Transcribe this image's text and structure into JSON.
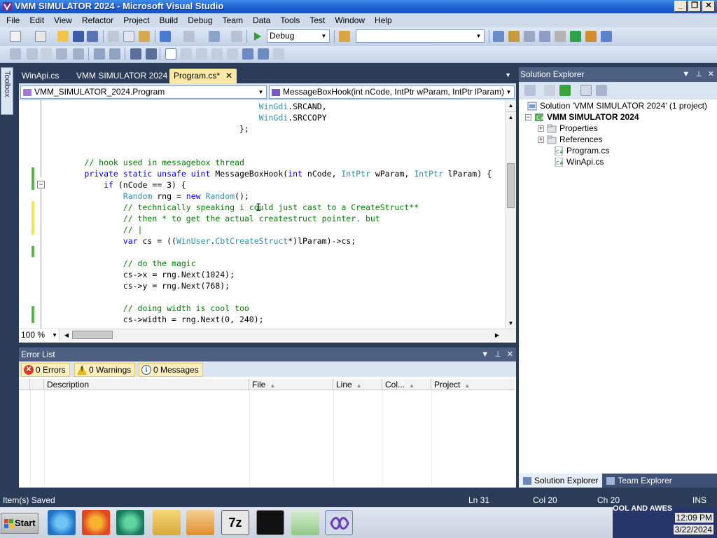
{
  "window": {
    "title": "VMM SIMULATOR 2024 - Microsoft Visual Studio",
    "buttons": [
      "_",
      "❐",
      "✕"
    ]
  },
  "menu": [
    "File",
    "Edit",
    "View",
    "Refactor",
    "Project",
    "Build",
    "Debug",
    "Team",
    "Data",
    "Tools",
    "Test",
    "Window",
    "Help"
  ],
  "toolbar": {
    "config_combo": "Debug",
    "find_combo": ""
  },
  "toolbox_label": "Toolbox",
  "doc_tabs": [
    {
      "label": "WinApi.cs",
      "active": false
    },
    {
      "label": "VMM SIMULATOR 2024",
      "active": false
    },
    {
      "label": "Program.cs*",
      "active": true
    }
  ],
  "nav": {
    "type_combo": "VMM_SIMULATOR_2024.Program",
    "member_combo": "MessageBoxHook(int nCode, IntPtr wParam, IntPtr lParam)"
  },
  "code_lines": [
    {
      "tokens": [
        {
          "t": "                                            "
        },
        {
          "t": "WinGdi",
          "c": "ty"
        },
        {
          "t": ".SRCAND,"
        }
      ]
    },
    {
      "tokens": [
        {
          "t": "                                            "
        },
        {
          "t": "WinGdi",
          "c": "ty"
        },
        {
          "t": ".SRCCOPY"
        }
      ]
    },
    {
      "tokens": [
        {
          "t": "                                        };"
        }
      ]
    },
    {
      "tokens": []
    },
    {
      "tokens": []
    },
    {
      "tokens": [
        {
          "t": "        "
        },
        {
          "t": "// hook used in messagebox thread",
          "c": "cm"
        }
      ]
    },
    {
      "tokens": [
        {
          "t": "        "
        },
        {
          "t": "private static unsafe uint",
          "c": "kw"
        },
        {
          "t": " MessageBoxHook("
        },
        {
          "t": "int",
          "c": "kw"
        },
        {
          "t": " nCode, "
        },
        {
          "t": "IntPtr",
          "c": "ty"
        },
        {
          "t": " wParam, "
        },
        {
          "t": "IntPtr",
          "c": "ty"
        },
        {
          "t": " lParam) {"
        }
      ]
    },
    {
      "tokens": [
        {
          "t": "            "
        },
        {
          "t": "if",
          "c": "kw"
        },
        {
          "t": " (nCode == 3) {"
        }
      ]
    },
    {
      "tokens": [
        {
          "t": "                "
        },
        {
          "t": "Random",
          "c": "ty"
        },
        {
          "t": " rng = "
        },
        {
          "t": "new",
          "c": "kw"
        },
        {
          "t": " "
        },
        {
          "t": "Random",
          "c": "ty"
        },
        {
          "t": "();"
        }
      ]
    },
    {
      "tokens": [
        {
          "t": "                "
        },
        {
          "t": "// technically speaking i could just cast to a CreateStruct**",
          "c": "cm"
        }
      ]
    },
    {
      "tokens": [
        {
          "t": "                "
        },
        {
          "t": "// then * to get the actual createstruct pointer. but",
          "c": "cm"
        }
      ]
    },
    {
      "tokens": [
        {
          "t": "                "
        },
        {
          "t": "// |",
          "c": "cm"
        }
      ]
    },
    {
      "tokens": [
        {
          "t": "                "
        },
        {
          "t": "var",
          "c": "kw"
        },
        {
          "t": " cs = (("
        },
        {
          "t": "WinUser",
          "c": "ty"
        },
        {
          "t": "."
        },
        {
          "t": "CbtCreateStruct",
          "c": "ty"
        },
        {
          "t": "*)lParam)->cs;"
        }
      ]
    },
    {
      "tokens": []
    },
    {
      "tokens": [
        {
          "t": "                "
        },
        {
          "t": "// do the magic",
          "c": "cm"
        }
      ]
    },
    {
      "tokens": [
        {
          "t": "                cs->x = rng.Next(1024);"
        }
      ]
    },
    {
      "tokens": [
        {
          "t": "                cs->y = rng.Next(768);"
        }
      ]
    },
    {
      "tokens": []
    },
    {
      "tokens": [
        {
          "t": "                "
        },
        {
          "t": "// doing width is cool too",
          "c": "cm"
        }
      ]
    },
    {
      "tokens": [
        {
          "t": "                cs->width = rng.Next(0, 240);"
        }
      ]
    }
  ],
  "editor": {
    "zoom": "100 %"
  },
  "error_list": {
    "title": "Error List",
    "errors_label": "0 Errors",
    "warnings_label": "0 Warnings",
    "messages_label": "0 Messages",
    "columns": [
      "Description",
      "File",
      "Line",
      "Col...",
      "Project"
    ]
  },
  "solution_explorer": {
    "title": "Solution Explorer",
    "solution": "Solution 'VMM SIMULATOR 2024' (1 project)",
    "project": "VMM SIMULATOR 2024",
    "items": [
      "Properties",
      "References",
      "Program.cs",
      "WinApi.cs"
    ],
    "tabs": [
      "Solution Explorer",
      "Team Explorer"
    ]
  },
  "status": {
    "message": "Item(s) Saved",
    "line": "Ln 31",
    "col": "Col 20",
    "ch": "Ch 20",
    "mode": "INS"
  },
  "taskbar": {
    "start": "Start",
    "background_text": "OOL AND AWES",
    "time": "12:09 PM",
    "date": "3/22/2024"
  },
  "colors": {
    "keyword": "#0000ff",
    "comment": "#008000",
    "type": "#2b91af",
    "panel_title": "#4d6082",
    "ide_background": "#2b3c59"
  }
}
